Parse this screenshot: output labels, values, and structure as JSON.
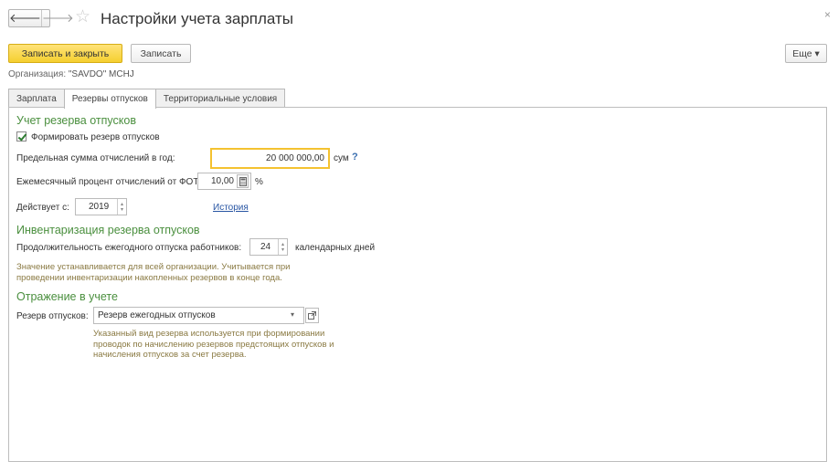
{
  "window": {
    "title": "Настройки учета зарплаты",
    "close_glyph": "×",
    "back_glyph": "🡐",
    "forward_glyph": "🡒",
    "star_glyph": "☆"
  },
  "toolbar": {
    "save_close_label": "Записать и закрыть",
    "save_label": "Записать",
    "more_label": "Еще ▾"
  },
  "organization": {
    "label": "Организация:",
    "value": "\"SAVDO\" MCHJ"
  },
  "tabs": [
    {
      "label": "Зарплата",
      "active": false
    },
    {
      "label": "Резервы отпусков",
      "active": true
    },
    {
      "label": "Территориальные условия",
      "active": false
    }
  ],
  "reserve": {
    "heading": "Учет резерва отпусков",
    "checkbox_label": "Формировать резерв отпусков",
    "checkbox_checked": true,
    "limit_label": "Предельная сумма отчислений в год:",
    "limit_value": "20 000 000,00",
    "limit_currency": "сум",
    "limit_help": "?",
    "percent_label": "Ежемесячный процент отчислений от ФОТ:",
    "percent_value": "10,00",
    "percent_unit": "%",
    "calc_icon": "calculator-icon",
    "effective_label": "Действует с:",
    "effective_year": "2019",
    "history_link": "История"
  },
  "inventory": {
    "heading": "Инвентаризация резерва отпусков",
    "duration_label": "Продолжительность ежегодного отпуска работников:",
    "duration_value": "24",
    "duration_unit": "календарных дней",
    "hint_line1": "Значение устанавливается для всей организации. Учитывается при",
    "hint_line2": "проведении инвентаризации накопленных резервов в конце года."
  },
  "accounting": {
    "heading": "Отражение в учете",
    "reserve_label": "Резерв отпусков:",
    "reserve_value": "Резерв ежегодных отпусков",
    "hint_line1": "Указанный вид резерва используется при формировании",
    "hint_line2": "проводок по начислению резервов предстоящих отпусков и",
    "hint_line3": "начисления отпусков за счет резерва."
  },
  "colors": {
    "accent_yellow": "#f5cf2f",
    "section_green": "#4a8f3e",
    "hint_brown": "#8a7a43",
    "link_blue": "#2855a3"
  }
}
